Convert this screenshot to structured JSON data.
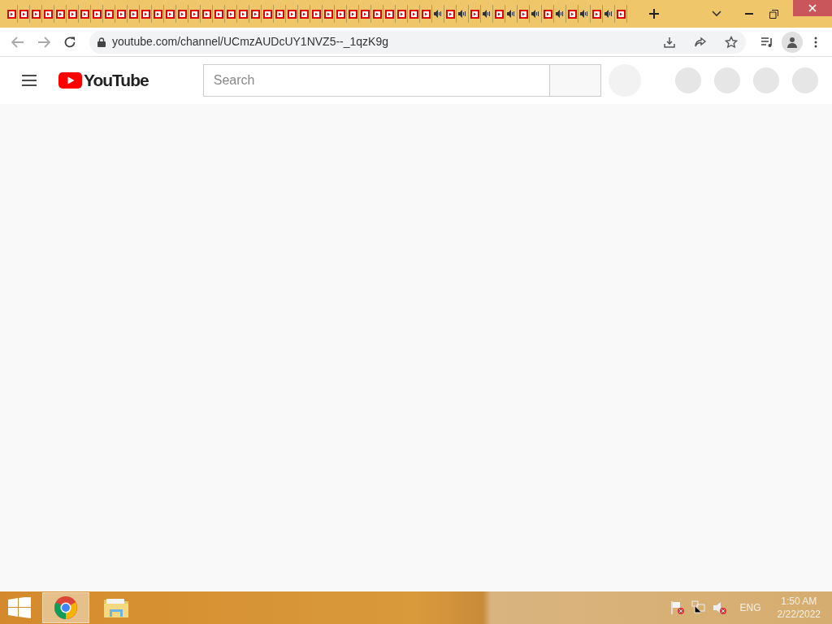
{
  "browser": {
    "tabs": [
      {
        "audio": false
      },
      {
        "audio": false
      },
      {
        "audio": false
      },
      {
        "audio": false
      },
      {
        "audio": false
      },
      {
        "audio": false
      },
      {
        "audio": false
      },
      {
        "audio": false
      },
      {
        "audio": false
      },
      {
        "audio": false
      },
      {
        "audio": false
      },
      {
        "audio": false
      },
      {
        "audio": false
      },
      {
        "audio": false
      },
      {
        "audio": false
      },
      {
        "audio": false
      },
      {
        "audio": false
      },
      {
        "audio": false
      },
      {
        "audio": false
      },
      {
        "audio": false
      },
      {
        "audio": false
      },
      {
        "audio": false
      },
      {
        "audio": false
      },
      {
        "audio": false
      },
      {
        "audio": false
      },
      {
        "audio": false
      },
      {
        "audio": false
      },
      {
        "audio": false
      },
      {
        "audio": false
      },
      {
        "audio": false
      },
      {
        "audio": false
      },
      {
        "audio": false
      },
      {
        "audio": false
      },
      {
        "audio": false
      },
      {
        "audio": false
      },
      {
        "audio": true
      },
      {
        "audio": false
      },
      {
        "audio": true
      },
      {
        "audio": false
      },
      {
        "audio": true
      },
      {
        "audio": false
      },
      {
        "audio": true
      },
      {
        "audio": false
      },
      {
        "audio": true
      },
      {
        "audio": false
      },
      {
        "audio": true
      },
      {
        "audio": false
      },
      {
        "audio": true
      },
      {
        "audio": false
      },
      {
        "audio": true
      },
      {
        "audio": false
      }
    ],
    "address": "youtube.com/channel/UCmzAUDcUY1NVZ5--_1qzK9g"
  },
  "page": {
    "logo_text": "YouTube",
    "search": {
      "placeholder": "Search"
    }
  },
  "taskbar": {
    "apps": [
      {
        "kind": "chrome",
        "selected": true
      },
      {
        "kind": "explorer",
        "selected": false
      }
    ],
    "language": "ENG",
    "time": "1:50 AM",
    "date": "2/22/2022"
  }
}
